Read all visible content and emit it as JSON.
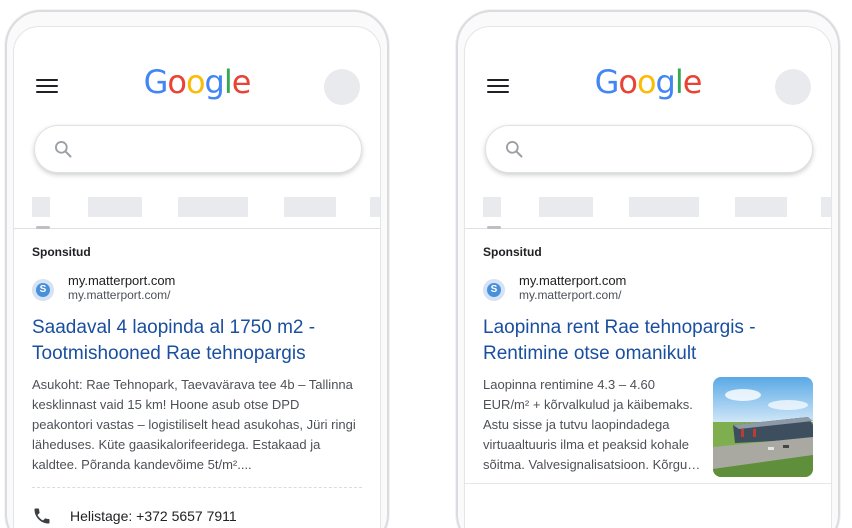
{
  "logo": {
    "letters": [
      "G",
      "o",
      "o",
      "g",
      "l",
      "e"
    ]
  },
  "left_ad": {
    "sponsored_label": "Sponsitud",
    "site_name": "my.matterport.com",
    "site_url": "my.matterport.com/",
    "title": "Saadaval 4 laopinda al 1750 m2 - Tootmishooned Rae tehnopargis",
    "description": "Asukoht: Rae Tehnopark, Taevavärava tee 4b – Tallinna kesklinnast vaid 15 km! Hoone asub otse DPD peakontori vastas – logistiliselt head asukohas, Jüri ringi läheduses. Küte gaasikalorifeeridega. Estakaad ja kaldtee. Põranda kandevõime 5t/m²....",
    "call_text": "Helistage: +372 5657 7911"
  },
  "right_ad": {
    "sponsored_label": "Sponsitud",
    "site_name": "my.matterport.com",
    "site_url": "my.matterport.com/",
    "title": "Laopinna rent Rae tehnopargis - Rentimine otse omanikult",
    "description": "Laopinna rentimine 4.3 – 4.60 EUR/m² + kõrvalkulud ja käibemaks. Astu sisse ja tutvu laopindadega virtuaaltuuris ilma et peaksid kohale sõitma. Valvesignalisatsioon. Kõrgu…"
  },
  "favicon_letter": "S",
  "colors": {
    "link": "#1a4fa0",
    "google_blue": "#4285f4",
    "google_red": "#ea4335",
    "google_yellow": "#fbbc05",
    "google_green": "#34a853"
  }
}
